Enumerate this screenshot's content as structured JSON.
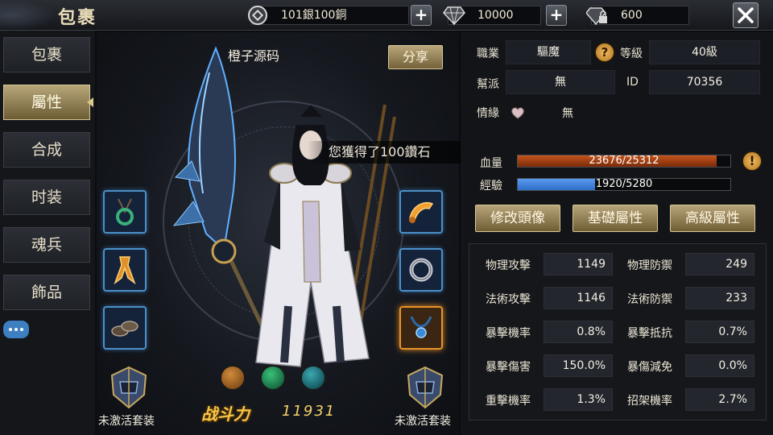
{
  "header": {
    "title": "包裹",
    "currency_silver": "101銀100銅",
    "currency_diamond": "10000",
    "currency_locked": "600"
  },
  "tabs": [
    {
      "label": "包裹"
    },
    {
      "label": "屬性"
    },
    {
      "label": "合成"
    },
    {
      "label": "时装"
    },
    {
      "label": "魂兵"
    },
    {
      "label": "飾品"
    }
  ],
  "character": {
    "name": "橙子源码",
    "share_label": "分享",
    "notice": "您獲得了100鑽石",
    "set_left_label": "未激活套装",
    "set_right_label": "未激活套装",
    "power_label": "战斗力",
    "power_value": "11931"
  },
  "info": {
    "job_label": "職業",
    "job_value": "驅魔",
    "level_label": "等級",
    "level_value": "40級",
    "guild_label": "幫派",
    "guild_value": "無",
    "id_label": "ID",
    "id_value": "70356",
    "love_label": "情緣",
    "love_value": "無",
    "hp_label": "血量",
    "hp_text": "23676/25312",
    "hp_fraction": 0.935,
    "exp_label": "經驗",
    "exp_text": "1920/5280",
    "exp_fraction": 0.364
  },
  "actions": {
    "avatar_label": "修改頭像",
    "basic_label": "基礎屬性",
    "advanced_label": "高級屬性"
  },
  "stats": [
    {
      "label": "物理攻擊",
      "value": "1149"
    },
    {
      "label": "物理防禦",
      "value": "249"
    },
    {
      "label": "法術攻擊",
      "value": "1146"
    },
    {
      "label": "法術防禦",
      "value": "233"
    },
    {
      "label": "暴擊機率",
      "value": "0.8%"
    },
    {
      "label": "暴擊抵抗",
      "value": "0.7%"
    },
    {
      "label": "暴擊傷害",
      "value": "150.0%"
    },
    {
      "label": "暴傷減免",
      "value": "0.0%"
    },
    {
      "label": "重擊機率",
      "value": "1.3%"
    },
    {
      "label": "招架機率",
      "value": "2.7%"
    }
  ],
  "colors": {
    "hp_bar": "#c4541c",
    "exp_bar": "#2f6ec8",
    "gold_accent": "#b7a479",
    "slot_border": "#4a90c8",
    "slot_highlight": "#e8922a"
  }
}
